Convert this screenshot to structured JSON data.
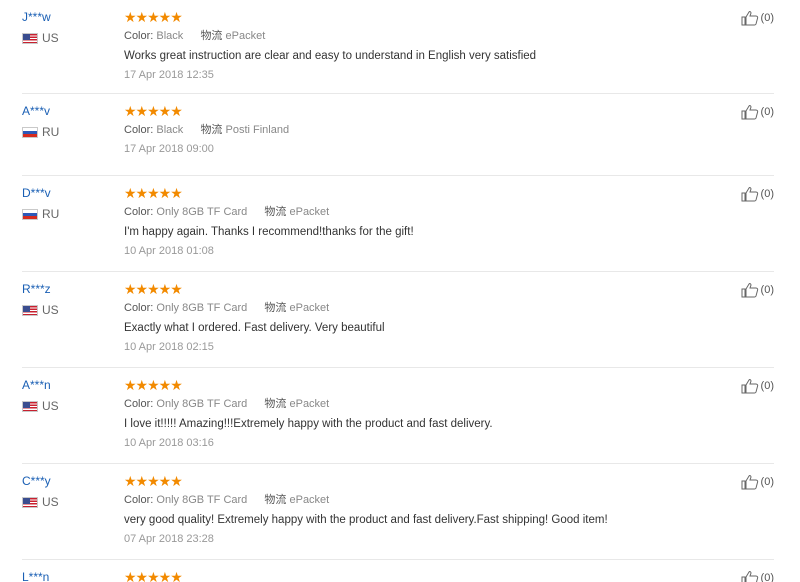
{
  "reviews": [
    {
      "user": "J***w",
      "country": "US",
      "flag": "us",
      "stars": "★★★★★",
      "color_label": "Color:",
      "color_value": "Black",
      "logistics_label": "物流",
      "logistics_value": "ePacket",
      "text": "Works great instruction are clear and easy to understand in English very satisfied",
      "date": "17 Apr 2018 12:35",
      "helpful_count": "(0)",
      "icon": "thumbs-up-icon"
    },
    {
      "user": "A***v",
      "country": "RU",
      "flag": "ru",
      "stars": "★★★★★",
      "color_label": "Color:",
      "color_value": "Black",
      "logistics_label": "物流",
      "logistics_value": "Posti Finland",
      "text": "",
      "date": "17 Apr 2018 09:00",
      "helpful_count": "(0)",
      "icon": "thumbs-up-icon"
    },
    {
      "user": "D***v",
      "country": "RU",
      "flag": "ru",
      "stars": "★★★★★",
      "color_label": "Color:",
      "color_value": "Only 8GB TF Card",
      "logistics_label": "物流",
      "logistics_value": "ePacket",
      "text": "I'm happy again. Thanks I recommend!thanks for the gift!",
      "date": "10 Apr 2018 01:08",
      "helpful_count": "(0)",
      "icon": "thumbs-up-icon"
    },
    {
      "user": "R***z",
      "country": "US",
      "flag": "us",
      "stars": "★★★★★",
      "color_label": "Color:",
      "color_value": "Only 8GB TF Card",
      "logistics_label": "物流",
      "logistics_value": "ePacket",
      "text": "Exactly what I ordered. Fast delivery. Very beautiful",
      "date": "10 Apr 2018 02:15",
      "helpful_count": "(0)",
      "icon": "thumbs-up-icon"
    },
    {
      "user": "A***n",
      "country": "US",
      "flag": "us",
      "stars": "★★★★★",
      "color_label": "Color:",
      "color_value": "Only 8GB TF Card",
      "logistics_label": "物流",
      "logistics_value": "ePacket",
      "text": "I love it!!!!! Amazing!!!Extremely happy with the product and fast delivery.",
      "date": "10 Apr 2018 03:16",
      "helpful_count": "(0)",
      "icon": "thumbs-up-icon"
    },
    {
      "user": "C***y",
      "country": "US",
      "flag": "us",
      "stars": "★★★★★",
      "color_label": "Color:",
      "color_value": "Only 8GB TF Card",
      "logistics_label": "物流",
      "logistics_value": "ePacket",
      "text": "very good quality! Extremely happy with the product and fast delivery.Fast shipping! Good item!",
      "date": "07 Apr 2018 23:28",
      "helpful_count": "(0)",
      "icon": "thumbs-up-icon"
    },
    {
      "user": "L***n",
      "country": "",
      "flag": "",
      "stars": "★★★★★",
      "color_label": "",
      "color_value": "",
      "logistics_label": "",
      "logistics_value": "",
      "text": "",
      "date": "",
      "helpful_count": "(0)",
      "icon": "thumbs-up-icon"
    }
  ],
  "colors": {
    "star": "#f28a00",
    "username": "#1a5fb4",
    "divider": "#e8e8e8",
    "meta_text": "#888888",
    "date_text": "#999999"
  }
}
